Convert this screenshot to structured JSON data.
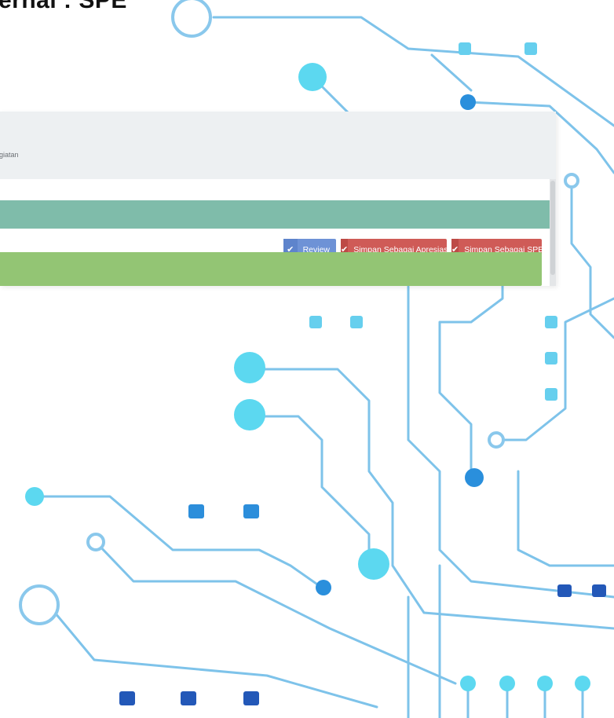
{
  "slide": {
    "title": "ernal : SPE"
  },
  "panel": {
    "breadcrumb_tail": "egiatan"
  },
  "actions": {
    "review_label": "Review",
    "save_appreciation_label": "Simpan Sebagai Apresiasi",
    "save_spe_label": "Simpan Sebagai SPE",
    "check_icon": "✔"
  },
  "colors": {
    "review_button": "#6e92d6",
    "save_buttons": "#cf5b57",
    "teal_bar": "#7fbcaa",
    "green_bar": "#93c574",
    "circuit_light": "#5cd8f0",
    "circuit_dark": "#2a8fdc"
  }
}
